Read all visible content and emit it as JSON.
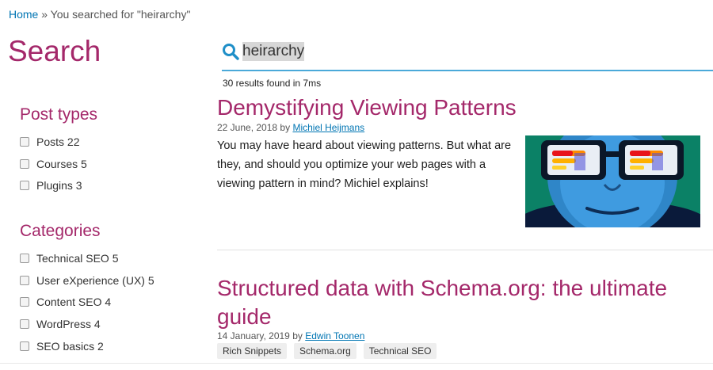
{
  "breadcrumb": {
    "home": "Home",
    "separator": " » ",
    "current": "You searched for \"heirarchy\""
  },
  "page": {
    "title": "Search"
  },
  "search": {
    "value": "heirarchy",
    "results_count": "30 results found in 7ms"
  },
  "sidebar": {
    "post_types_heading": "Post types",
    "post_types": [
      {
        "label": "Posts 22"
      },
      {
        "label": "Courses 5"
      },
      {
        "label": "Plugins 3"
      }
    ],
    "categories_heading": "Categories",
    "categories": [
      {
        "label": "Technical SEO 5"
      },
      {
        "label": "User eXperience (UX) 5"
      },
      {
        "label": "Content SEO 4"
      },
      {
        "label": "WordPress 4"
      },
      {
        "label": "SEO basics 2"
      }
    ]
  },
  "results": [
    {
      "title": "Demystifying Viewing Patterns",
      "date": "22 June, 2018",
      "by": "by",
      "author": "Michiel Heijmans",
      "excerpt": "You may have heard about viewing patterns. But what are they, and should you optimize your web pages with a viewing pattern in mind? Michiel explains!"
    },
    {
      "title": "Structured data with Schema.org: the ultimate guide",
      "date": "14 January, 2019",
      "by": "by",
      "author": "Edwin Toonen",
      "tags": [
        "Rich Snippets",
        "Schema.org",
        "Technical SEO"
      ]
    }
  ],
  "colors": {
    "accent": "#a4286a",
    "link": "#0075b3",
    "search_underline": "#4aa9d9"
  }
}
